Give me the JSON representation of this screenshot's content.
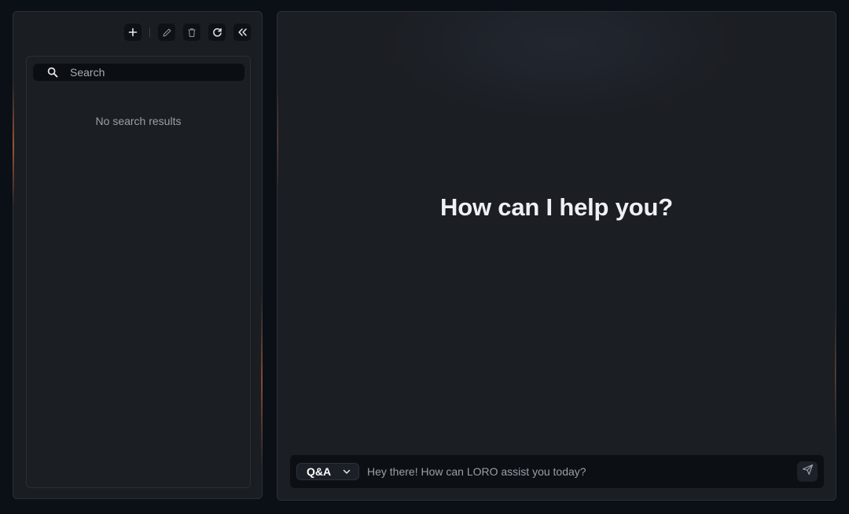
{
  "sidebar": {
    "toolbar": {
      "new_icon": "plus-icon",
      "edit_icon": "pencil-icon",
      "delete_icon": "trash-icon",
      "refresh_icon": "refresh-icon",
      "collapse_icon": "double-chevron-left-icon"
    },
    "search": {
      "placeholder": "Search",
      "value": "",
      "icon": "search-icon"
    },
    "empty_message": "No search results"
  },
  "main": {
    "greeting": "How can I help you?",
    "composer": {
      "mode": "Q&A",
      "placeholder": "Hey there! How can LORO assist you today?",
      "value": "",
      "send_icon": "send-icon"
    }
  },
  "colors": {
    "background": "#0b0f16",
    "panel": "#1b1e23",
    "accent_glow": "#ff783c",
    "text_primary": "#eef0f3",
    "text_muted": "#9aa0a8"
  }
}
